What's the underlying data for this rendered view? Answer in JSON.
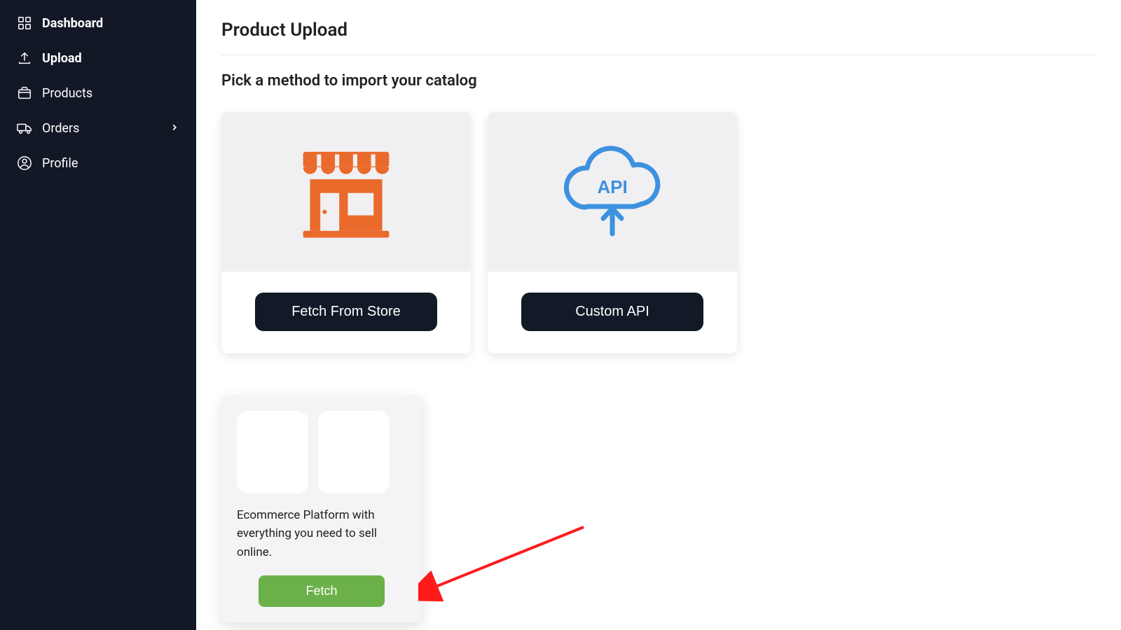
{
  "sidebar": {
    "items": [
      {
        "label": "Dashboard"
      },
      {
        "label": "Upload"
      },
      {
        "label": "Products"
      },
      {
        "label": "Orders"
      },
      {
        "label": "Profile"
      }
    ]
  },
  "page": {
    "title": "Product Upload",
    "subtitle": "Pick a method to import your catalog"
  },
  "methods": {
    "store_label": "Fetch From Store",
    "api_label": "Custom API",
    "api_icon_text": "API"
  },
  "platform": {
    "description": "Ecommerce Platform with everything you need to sell online.",
    "fetch_label": "Fetch"
  }
}
